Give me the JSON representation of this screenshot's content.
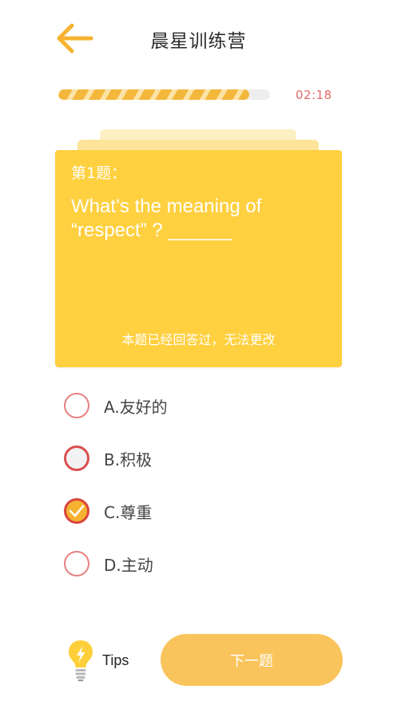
{
  "header": {
    "title": "晨星训练营",
    "back_icon": "arrow-left-icon"
  },
  "progress": {
    "fraction": 0.9,
    "timer": "02:18"
  },
  "question": {
    "number_label": "第1题：",
    "text": "What’s the meaning of\n“respect” ? ______",
    "note": "本题已经回答过，无法更改"
  },
  "options": [
    {
      "label": "A.友好的",
      "state": "unselected"
    },
    {
      "label": "B.积极",
      "state": "wrong"
    },
    {
      "label": "C.尊重",
      "state": "selected"
    },
    {
      "label": "D.主动",
      "state": "unselected"
    }
  ],
  "footer": {
    "tips_label": "Tips",
    "tips_icon": "lightbulb-icon",
    "next_label": "下一题"
  },
  "colors": {
    "accent": "#f6b32f",
    "card": "#ffd03f",
    "timer": "#e36a6a",
    "next_button": "#f9c45b"
  }
}
